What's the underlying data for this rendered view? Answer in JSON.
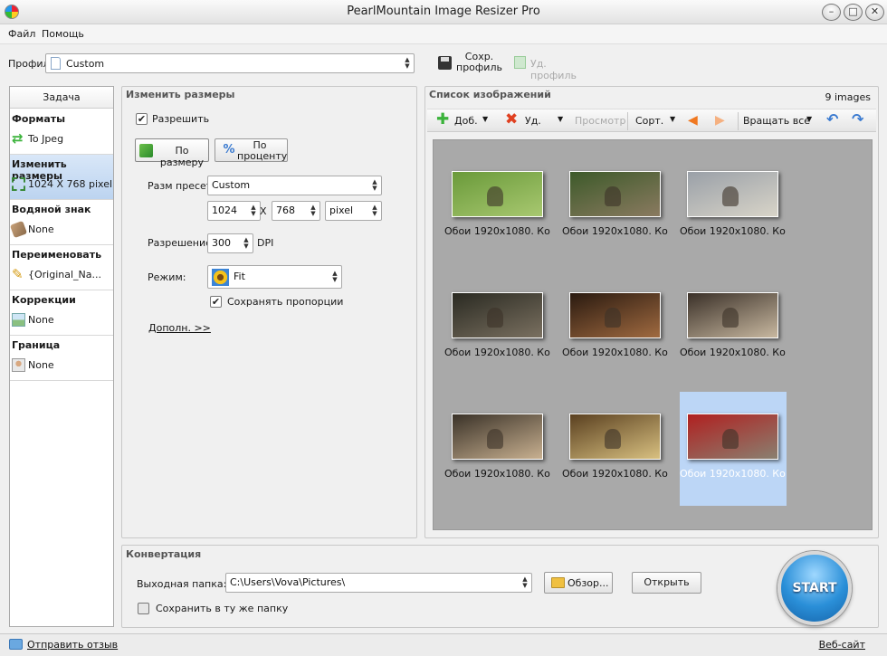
{
  "window": {
    "title": "PearlMountain Image Resizer Pro",
    "controls": {
      "minimize": "–",
      "maximize": "□",
      "close": "✕"
    }
  },
  "menu": [
    "Файл",
    "Помощь"
  ],
  "profile": {
    "label": "Профиль",
    "value": "Custom",
    "save_label": "Сохр.\nпрофиль",
    "delete_label": "Уд. профиль"
  },
  "task_panel": {
    "header": "Задача",
    "items": [
      {
        "title": "Форматы",
        "value": "To Jpeg",
        "icon": "convert-icon"
      },
      {
        "title": "Изменить размеры",
        "value": "1024 X 768 pixel",
        "icon": "resize-icon"
      },
      {
        "title": "Водяной знак",
        "value": "None",
        "icon": "watermark-icon"
      },
      {
        "title": "Переименовать",
        "value": "{Original_Na...",
        "icon": "pencil-icon"
      },
      {
        "title": "Коррекции",
        "value": "None",
        "icon": "image-icon"
      },
      {
        "title": "Граница",
        "value": "None",
        "icon": "portrait-icon"
      }
    ]
  },
  "resize_panel": {
    "title": "Изменить размеры",
    "enable_label": "Разрешить",
    "by_size_label": "По размеру",
    "by_percent_label": "По\nпроценту",
    "preset_label": "Разм пресета",
    "preset_value": "Custom",
    "width": "1024",
    "x_label": "X",
    "height": "768",
    "unit": "pixel",
    "resolution_label": "Разрешение:",
    "resolution_value": "300",
    "dpi_label": "DPI",
    "mode_label": "Режим:",
    "mode_value": "Fit",
    "keep_ratio_label": "Сохранять пропорции",
    "more_link": "Дополн. >>"
  },
  "images_panel": {
    "title": "Список изображений",
    "count": "9 images",
    "toolbar": {
      "add": "Доб.",
      "delete": "Уд.",
      "preview": "Просмотр",
      "sort": "Сорт.",
      "rotate_all": "Вращать все"
    },
    "thumbnails": [
      {
        "label": "Обои 1920x1080. Ко...",
        "colors": [
          "#6a9a3a",
          "#a8c870"
        ]
      },
      {
        "label": "Обои 1920x1080. Ко...",
        "colors": [
          "#3d5a2a",
          "#8a7a60"
        ]
      },
      {
        "label": "Обои 1920x1080. Ко...",
        "colors": [
          "#9aa0a8",
          "#d8d4c8"
        ]
      },
      {
        "label": "Обои 1920x1080. Ко...",
        "colors": [
          "#2a2a22",
          "#7a7060"
        ]
      },
      {
        "label": "Обои 1920x1080. Ко...",
        "colors": [
          "#2a1a10",
          "#a06a40"
        ]
      },
      {
        "label": "Обои 1920x1080. Ко...",
        "colors": [
          "#3a3028",
          "#c8b8a0"
        ]
      },
      {
        "label": "Обои 1920x1080. Ко...",
        "colors": [
          "#3a3228",
          "#c8b090"
        ]
      },
      {
        "label": "Обои 1920x1080. Ко...",
        "colors": [
          "#5a4020",
          "#d8c080"
        ]
      },
      {
        "label": "Обои 1920x1080. Ко...",
        "colors": [
          "#b02020",
          "#8a8070"
        ]
      }
    ],
    "selected_index": 8
  },
  "convert_panel": {
    "title": "Конвертация",
    "output_label": "Выходная папка:",
    "output_value": "C:\\Users\\Vova\\Pictures\\",
    "browse_label": "Обзор...",
    "open_label": "Открыть",
    "same_folder_label": "Сохранить в ту же папку",
    "start_label": "START"
  },
  "status": {
    "feedback_link": "Отправить отзыв",
    "website_link": "Веб-сайт"
  },
  "colors": {
    "accent_blue": "#2a8fd8",
    "task_active": "#bcd4f0",
    "thumb_selected": "#bcd6f6",
    "add_green": "#3bb33b",
    "delete_red": "#e04020",
    "arrow_orange": "#f07820",
    "rotate_blue": "#3a7ad0"
  }
}
